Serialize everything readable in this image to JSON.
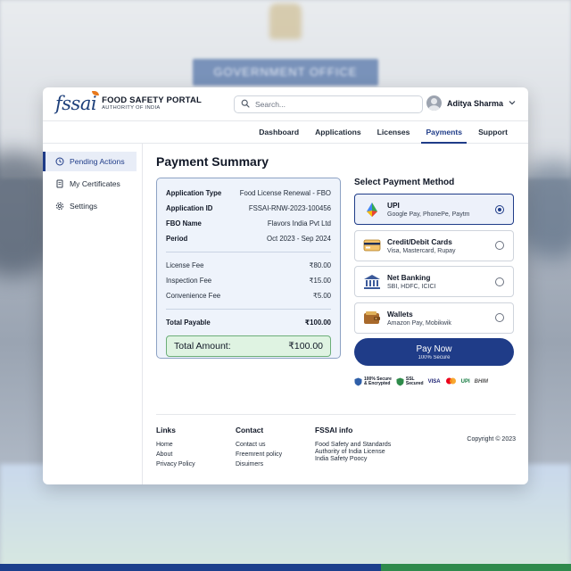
{
  "background": {
    "sign_text": "GOVERNMENT OFFICE",
    "bar_colors": [
      "#1c3f8c",
      "#1c3f8c",
      "#2f8a4c"
    ]
  },
  "brand": {
    "logo_text": "fssai",
    "title": "FOOD SAFETY PORTAL",
    "subtitle": "AUTHORITY OF INDIA"
  },
  "search": {
    "placeholder": "Search..."
  },
  "user": {
    "name": "Aditya Sharma"
  },
  "nav": {
    "items": [
      "Dashboard",
      "Applications",
      "Licenses",
      "Payments",
      "Support"
    ],
    "active": "Payments"
  },
  "sidebar": {
    "items": [
      "Pending Actions",
      "My Certificates",
      "Settings"
    ],
    "active": "Pending Actions"
  },
  "page": {
    "title": "Payment Summary"
  },
  "summary": {
    "details": [
      {
        "k": "Application Type",
        "v": "Food License Renewal - FBO"
      },
      {
        "k": "Application ID",
        "v": "FSSAI-RNW-2023-100456"
      },
      {
        "k": "FBO Name",
        "v": "Flavors India Pvt Ltd"
      },
      {
        "k": "Period",
        "v": "Oct 2023 - Sep 2024"
      }
    ],
    "fees": [
      {
        "k": "License Fee",
        "v": "₹80.00"
      },
      {
        "k": "Inspection Fee",
        "v": "₹15.00"
      },
      {
        "k": "Convenience Fee",
        "v": "₹5.00"
      }
    ],
    "total_payable": {
      "k": "Total Payable",
      "v": "₹100.00"
    },
    "total_amount": {
      "k": "Total Amount:",
      "v": "₹100.00"
    }
  },
  "payment": {
    "title": "Select Payment Method",
    "methods": [
      {
        "title": "UPI",
        "sub": "Google Pay, PhonePe, Paytm",
        "icon": "upi-icon",
        "selected": true
      },
      {
        "title": "Credit/Debit Cards",
        "sub": "Visa, Mastercard, Rupay",
        "icon": "credit-card-icon",
        "selected": false
      },
      {
        "title": "Net Banking",
        "sub": "SBI, HDFC, ICICI",
        "icon": "bank-icon",
        "selected": false
      },
      {
        "title": "Wallets",
        "sub": "Amazon Pay, Mobikwik",
        "icon": "wallet-icon",
        "selected": false
      }
    ],
    "button": {
      "label": "Pay Now",
      "sub": "100% Secure"
    },
    "trust": {
      "secure_1": "100% Secure",
      "secure_2": "& Encrypted",
      "ssl_1": "SSL",
      "ssl_2": "Secured",
      "visa": "VISA",
      "upi": "UPI",
      "bhim": "BHIM"
    }
  },
  "footer": {
    "links": {
      "head": "Links",
      "items": [
        "Home",
        "About",
        "Privacy Policy"
      ]
    },
    "contact": {
      "head": "Contact",
      "items": [
        "Contact us",
        "Freemrent policy",
        "Disuimers"
      ]
    },
    "info": {
      "head": "FSSAI info",
      "items": [
        "Food Safety and Standards",
        "Authority of India License",
        "India Safety Poocy"
      ]
    },
    "copyright": "Copyright © 2023"
  },
  "colors": {
    "primary": "#1f3c88",
    "success_bg": "#dff3e2",
    "success_border": "#6cae79",
    "summary_bg": "#eef3fb"
  }
}
